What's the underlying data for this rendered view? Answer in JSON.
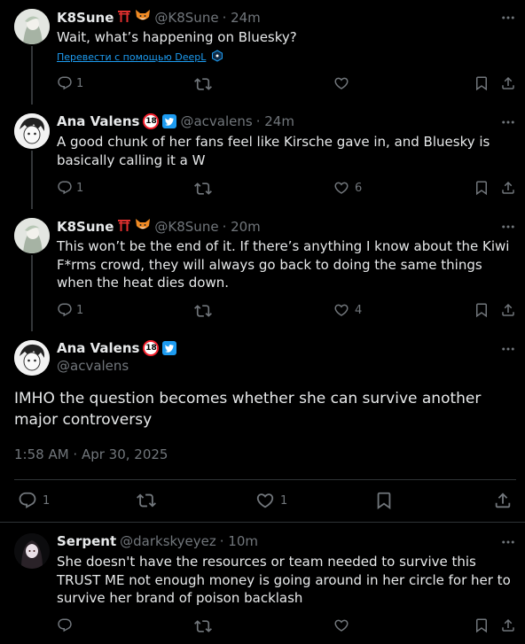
{
  "replies": [
    {
      "name": "K8Sune",
      "handle": "@K8Sune",
      "time": "· 24m",
      "text": "Wait, what’s happening on Bluesky?",
      "translate": "Перевести с помощью DeepL",
      "reply_count": "1",
      "like_count": ""
    },
    {
      "name": "Ana Valens",
      "badge": "18",
      "handle": "@acvalens",
      "time": "· 24m",
      "text": "A good chunk of her fans feel like Kirsche gave in, and Bluesky is basically calling it a W",
      "reply_count": "1",
      "like_count": "6"
    },
    {
      "name": "K8Sune",
      "handle": "@K8Sune",
      "time": "· 20m",
      "text": "This won’t be the end of it. If there’s anything I know about the Kiwi F*rms crowd, they will always go back to doing the same things when the heat dies down.",
      "reply_count": "1",
      "like_count": "4"
    }
  ],
  "main_post": {
    "name": "Ana Valens",
    "badge": "18",
    "handle": "@acvalens",
    "text": "IMHO the question becomes whether she can survive another major controversy",
    "timestamp": "1:58 AM · Apr 30, 2025",
    "reply_count": "1",
    "like_count": "1"
  },
  "bottom_reply": {
    "name": "Serpent",
    "handle": "@darkskyeyez",
    "time": "· 10m",
    "text": "She doesn't have the resources or team needed to survive this TRUST ME not enough money is going around in her circle for her to survive her brand of poison backlash"
  },
  "icons": {
    "reply": "reply-icon",
    "repost": "repost-icon",
    "like": "like-icon",
    "bookmark": "bookmark-icon",
    "share": "share-icon",
    "more": "more-icon",
    "translate": "deepl-icon",
    "verified": "twitter-bird-icon"
  },
  "colors": {
    "background": "#000000",
    "text": "#e7e9ea",
    "muted": "#71767b",
    "link": "#1d9bf0",
    "divider": "#2f3336"
  }
}
